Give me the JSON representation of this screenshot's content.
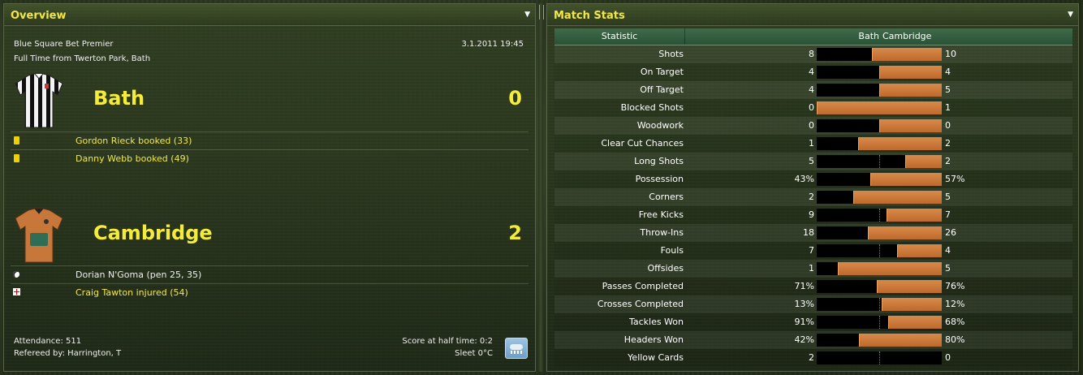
{
  "overview": {
    "title": "Overview",
    "competition": "Blue Square Bet Premier",
    "datetime": "3.1.2011 19:45",
    "subtitle": "Full Time from Twerton Park, Bath",
    "home": {
      "name": "Bath",
      "score": "0",
      "events": [
        {
          "type": "yellow-card",
          "text": "Gordon Rieck booked (33)"
        },
        {
          "type": "yellow-card",
          "text": "Danny Webb booked (49)"
        }
      ]
    },
    "away": {
      "name": "Cambridge",
      "score": "2",
      "events": [
        {
          "type": "goal",
          "text": "Dorian N'Goma (pen 25, 35)"
        },
        {
          "type": "injury",
          "text": "Craig Tawton injured (54)"
        }
      ]
    },
    "attendance": "Attendance: 511",
    "referee": "Refereed by: Harrington, T",
    "halftime": "Score at half time: 0:2",
    "weather": "Sleet 0°C"
  },
  "stats": {
    "title": "Match Stats",
    "header": {
      "statistic": "Statistic",
      "home": "Bath",
      "away": "Cambridge"
    },
    "rows": [
      {
        "label": "Shots",
        "home": "8",
        "away": "10",
        "share": 0.56
      },
      {
        "label": "On Target",
        "home": "4",
        "away": "4",
        "share": 0.5
      },
      {
        "label": "Off Target",
        "home": "4",
        "away": "5",
        "share": 0.5
      },
      {
        "label": "Blocked Shots",
        "home": "0",
        "away": "1",
        "share": 1.0
      },
      {
        "label": "Woodwork",
        "home": "0",
        "away": "0",
        "share": 0.5
      },
      {
        "label": "Clear Cut Chances",
        "home": "1",
        "away": "2",
        "share": 0.67
      },
      {
        "label": "Long Shots",
        "home": "5",
        "away": "2",
        "share": 0.29
      },
      {
        "label": "Possession",
        "home": "43%",
        "away": "57%",
        "share": 0.57
      },
      {
        "label": "Corners",
        "home": "2",
        "away": "5",
        "share": 0.71
      },
      {
        "label": "Free Kicks",
        "home": "9",
        "away": "7",
        "share": 0.44
      },
      {
        "label": "Throw-Ins",
        "home": "18",
        "away": "26",
        "share": 0.59
      },
      {
        "label": "Fouls",
        "home": "7",
        "away": "4",
        "share": 0.36
      },
      {
        "label": "Offsides",
        "home": "1",
        "away": "5",
        "share": 0.83
      },
      {
        "label": "Passes Completed",
        "home": "71%",
        "away": "76%",
        "share": 0.52
      },
      {
        "label": "Crosses Completed",
        "home": "13%",
        "away": "12%",
        "share": 0.48
      },
      {
        "label": "Tackles Won",
        "home": "91%",
        "away": "68%",
        "share": 0.43
      },
      {
        "label": "Headers Won",
        "home": "42%",
        "away": "80%",
        "share": 0.66
      },
      {
        "label": "Yellow Cards",
        "home": "2",
        "away": "0",
        "share": 0.0
      }
    ]
  }
}
